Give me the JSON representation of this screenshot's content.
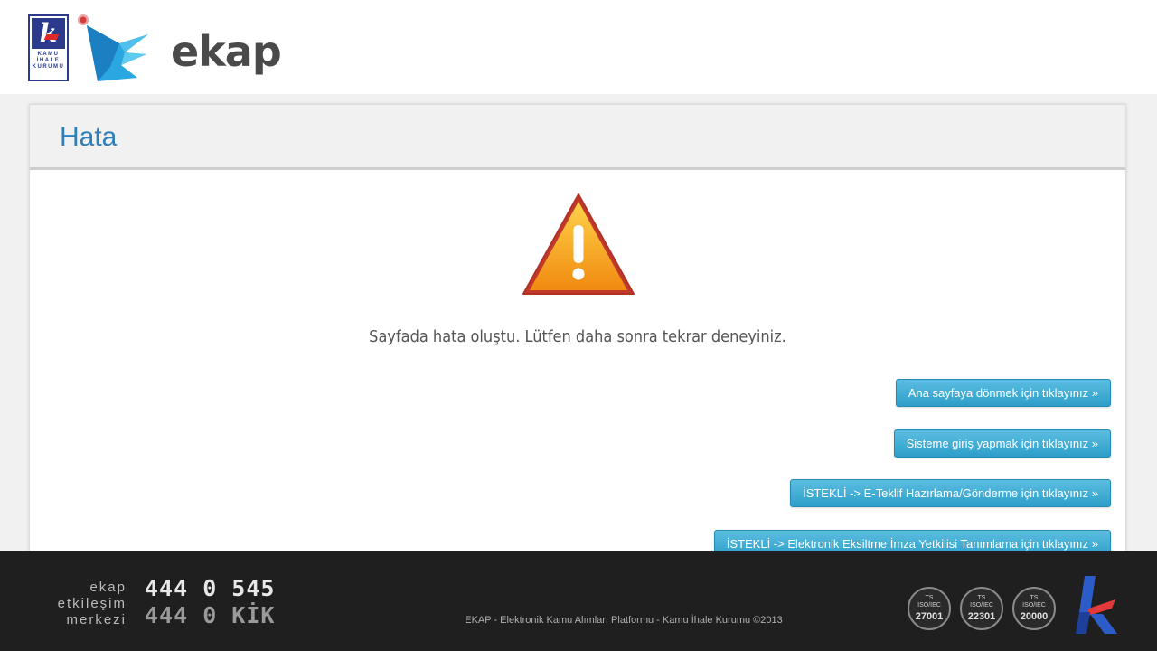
{
  "header": {
    "kik_logo": {
      "letter": "k",
      "lines": [
        "KAMU",
        "İHALE",
        "KURUMU"
      ]
    },
    "brand": "ekap"
  },
  "panel": {
    "title": "Hata",
    "warning_icon": "warning-triangle-icon",
    "message": "Sayfada hata oluştu. Lütfen daha sonra tekrar deneyiniz.",
    "buttons": {
      "home": "Ana sayfaya dönmek için tıklayınız »",
      "login": "Sisteme giriş yapmak için tıklayınız »",
      "eteklif": "İSTEKLİ -> E-Teklif Hazırlama/Gönderme için tıklayınız »",
      "eksiltme": "İSTEKLİ -> Elektronik Eksiltme İmza Yetkilisi Tanımlama için tıklayınız »"
    }
  },
  "footer": {
    "label_lines": [
      "ekap",
      "etkileşim",
      "merkezi"
    ],
    "phone_1": "444 0 545",
    "phone_2": "444 0 KİK",
    "copyright": "EKAP - Elektronik Kamu Alımları Platformu - Kamu İhale Kurumu ©2013",
    "certs": [
      {
        "prefix": "TS",
        "std": "ISO/IEC",
        "number": "27001"
      },
      {
        "prefix": "TS",
        "std": "ISO/IEC",
        "number": "22301"
      },
      {
        "prefix": "TS",
        "std": "ISO/IEC",
        "number": "20000"
      }
    ]
  },
  "colors": {
    "title_blue": "#2f7fb8",
    "button_blue": "#2d9fca",
    "warning_orange": "#f39a1c",
    "footer_bg": "#1f1f1f"
  }
}
